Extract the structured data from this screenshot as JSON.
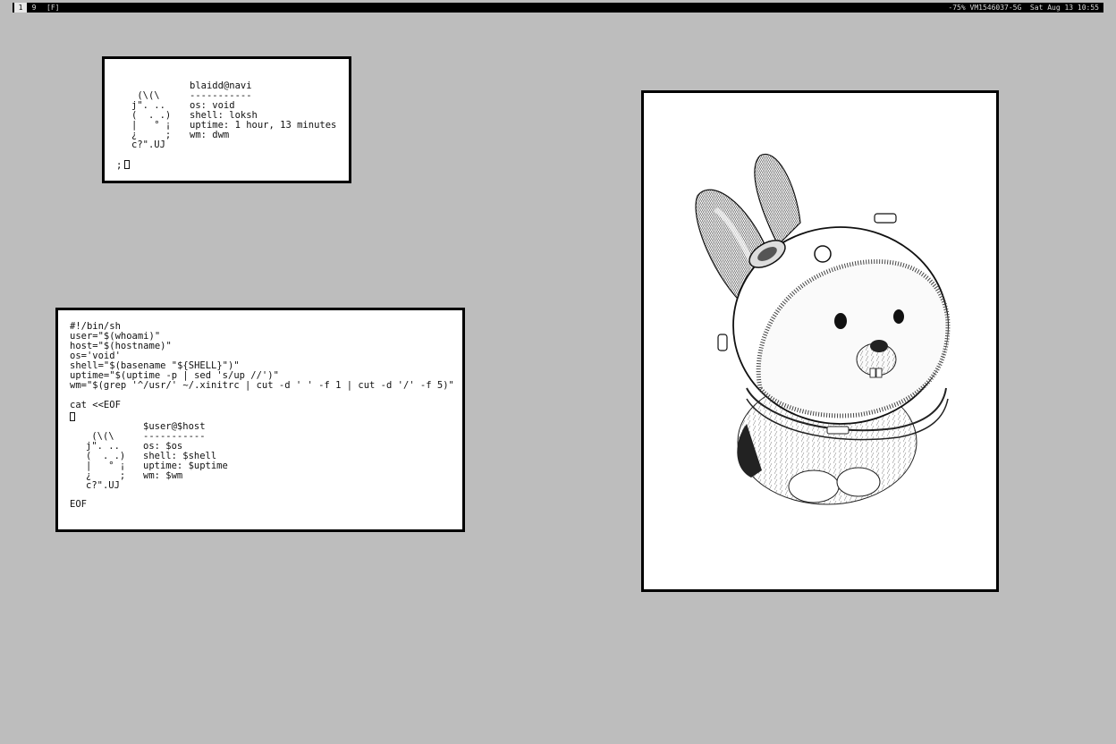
{
  "bar": {
    "tags": [
      "1",
      "9"
    ],
    "layout": "[F]",
    "status": "-75% VM1546037-5G  Sat Aug 13 10:55"
  },
  "fetch_window": {
    "art": [
      " (\\(\\",
      "j\". ..",
      "(  . .)",
      "|   ° ¡",
      "¿     ;",
      "c?\".UJ"
    ],
    "info": [
      "blaidd@navi",
      "-----------",
      "os: void",
      "shell: loksh",
      "uptime: 1 hour, 13 minutes",
      "wm: dwm"
    ],
    "prompt": ";"
  },
  "script_window": {
    "code": [
      "#!/bin/sh",
      "user=\"$(whoami)\"",
      "host=\"$(hostname)\"",
      "os='void'",
      "shell=\"$(basename \"${SHELL}\")\"",
      "uptime=\"$(uptime -p | sed 's/up //')\"",
      "wm=\"$(grep '^/usr/' ~/.xinitrc | cut -d ' ' -f 1 | cut -d '/' -f 5)\"",
      "",
      "cat <<EOF"
    ],
    "heredoc_art": [
      " (\\(\\",
      "j\". ..",
      "(  . .)",
      "|   ° ¡",
      "¿     ;",
      "c?\".UJ"
    ],
    "heredoc_info": [
      "$user@$host",
      "-----------",
      "os: $os",
      "shell: $shell",
      "uptime: $uptime",
      "wm: $wm"
    ],
    "eof": "EOF"
  },
  "image_window": {
    "subject": "bunny-astronaut-drawing"
  }
}
